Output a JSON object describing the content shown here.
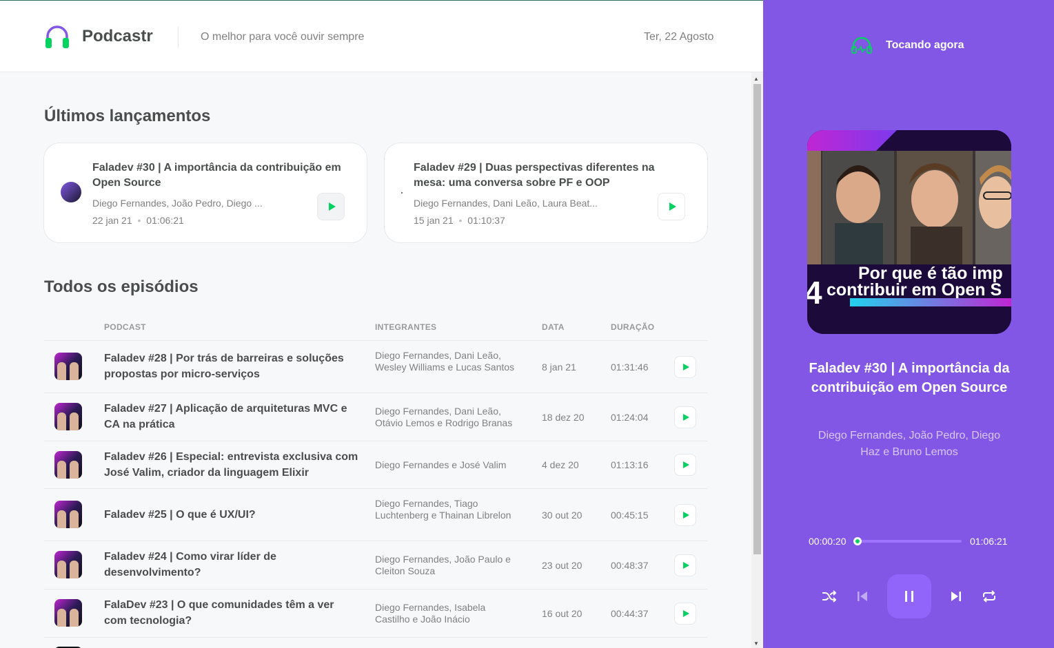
{
  "header": {
    "logo_text": "Podcastr",
    "tagline": "O melhor para você ouvir sempre",
    "date": "Ter, 22 Agosto"
  },
  "latest": {
    "heading": "Últimos lançamentos",
    "items": [
      {
        "title": "Faladev #30 | A importância da contribuição em Open Source",
        "members": "Diego Fernandes, João Pedro, Diego ...",
        "date": "22 jan 21",
        "duration": "01:06:21"
      },
      {
        "title": "Faladev #29 | Duas perspectivas diferentes na mesa: uma conversa sobre PF e OOP",
        "members": "Diego Fernandes, Dani Leão, Laura Beat...",
        "date": "15 jan 21",
        "duration": "01:10:37"
      }
    ]
  },
  "all": {
    "heading": "Todos os episódios",
    "columns": {
      "podcast": "PODCAST",
      "members": "INTEGRANTES",
      "date": "DATA",
      "duration": "DURAÇÃO"
    },
    "rows": [
      {
        "title": "Faladev #28 | Por trás de barreiras e soluções propostas por micro-serviços",
        "members": "Diego Fernandes, Dani Leão, Wesley Williams e Lucas Santos",
        "date": "8 jan 21",
        "duration": "01:31:46"
      },
      {
        "title": "Faladev #27 | Aplicação de arquiteturas MVC e CA na prática",
        "members": "Diego Fernandes, Dani Leão, Otávio Lemos e Rodrigo Branas",
        "date": "18 dez 20",
        "duration": "01:24:04"
      },
      {
        "title": "Faladev #26 | Especial: entrevista exclusiva com José Valim, criador da linguagem Elixir",
        "members": "Diego Fernandes e José Valim",
        "date": "4 dez 20",
        "duration": "01:13:16"
      },
      {
        "title": "Faladev #25 | O que é UX/UI?",
        "members": "Diego Fernandes, Tiago Luchtenberg e Thainan Librelon",
        "date": "30 out 20",
        "duration": "00:45:15"
      },
      {
        "title": "Faladev #24 | Como virar líder de desenvolvimento?",
        "members": "Diego Fernandes, João Paulo e Cleiton Souza",
        "date": "23 out 20",
        "duration": "00:48:37"
      },
      {
        "title": "FalaDev #23 | O que comunidades têm a ver com tecnologia?",
        "members": "Diego Fernandes, Isabela Castilho e João Inácio",
        "date": "16 out 20",
        "duration": "00:44:37"
      }
    ]
  },
  "player": {
    "label": "Tocando agora",
    "cover_line1": "Por que é tão imp",
    "cover_line2": "contribuir em Open S",
    "cover_number": "4",
    "title": "Faladev #30 | A importância da contribuição em Open Source",
    "members": "Diego Fernandes, João Pedro, Diego Haz e Bruno Lemos",
    "current_time": "00:00:20",
    "total_time": "01:06:21",
    "progress": 0.005
  },
  "colors": {
    "accent": "#8257e5",
    "green": "#04d361"
  }
}
